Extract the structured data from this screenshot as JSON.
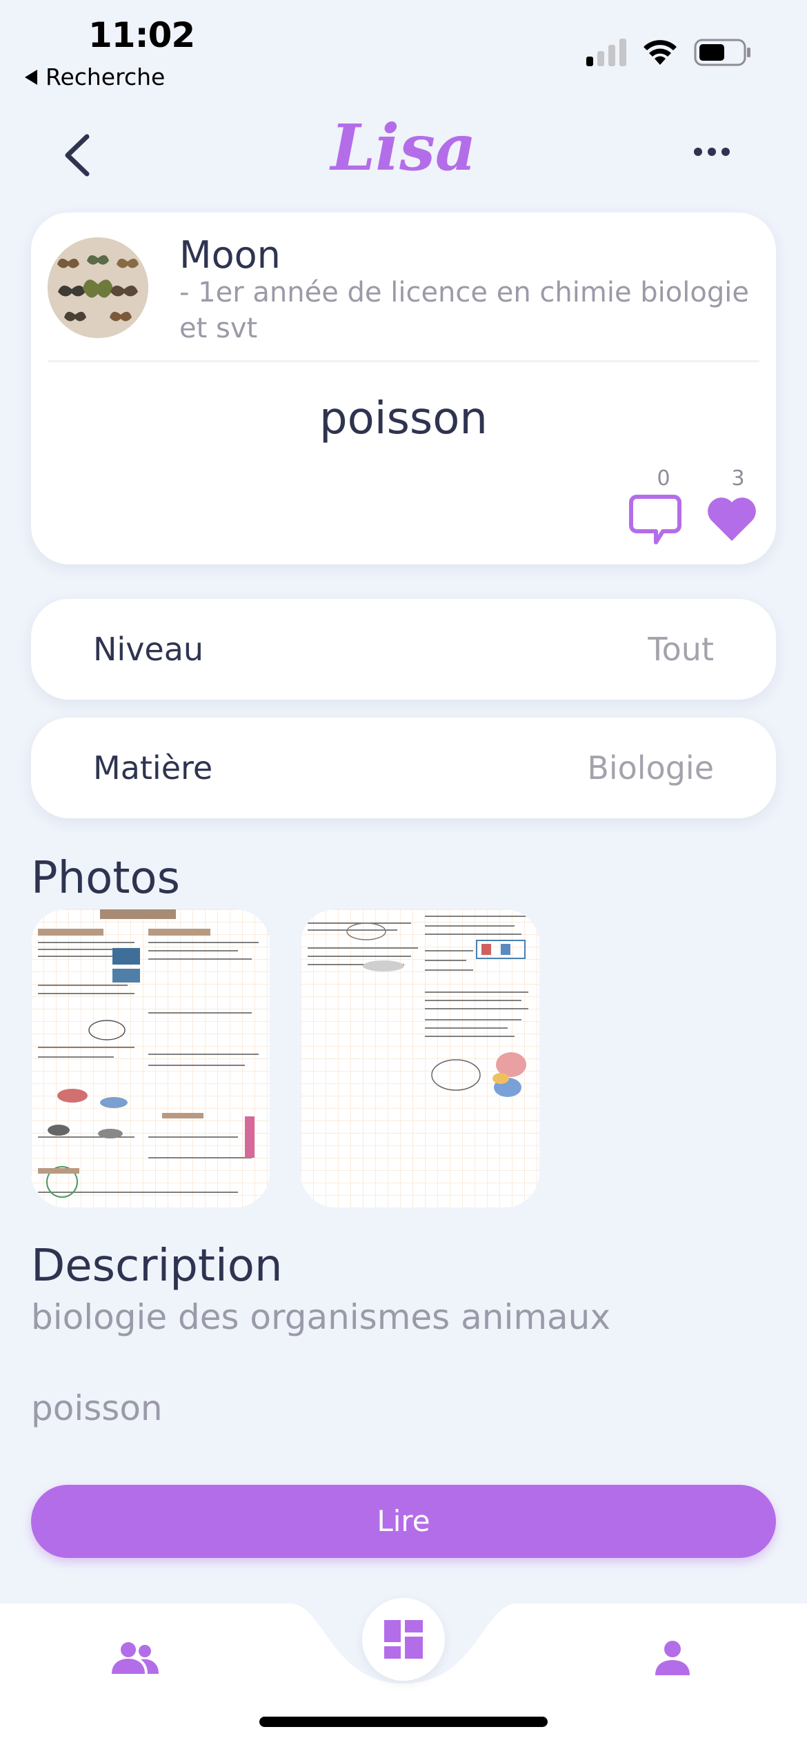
{
  "status_bar": {
    "time": "11:02",
    "back_app": "Recherche"
  },
  "header": {
    "app_title": "Lisa"
  },
  "post": {
    "author_name": "Moon",
    "author_meta": "- 1er année de licence en chimie biologie et svt",
    "title": "poisson",
    "comment_count": "0",
    "like_count": "3"
  },
  "filters": {
    "niveau": {
      "label": "Niveau",
      "value": "Tout"
    },
    "matiere": {
      "label": "Matière",
      "value": "Biologie"
    }
  },
  "photos": {
    "section_title": "Photos"
  },
  "description": {
    "section_title": "Description",
    "text": "biologie des organismes animaux",
    "extra": "poisson"
  },
  "actions": {
    "read_label": "Lire"
  },
  "colors": {
    "accent": "#b46de8",
    "text_dark": "#2e3450",
    "text_muted": "#9a9aa8",
    "background": "#eff3fa"
  },
  "icons": [
    "back-chevron-icon",
    "more-icon",
    "comment-icon",
    "heart-icon",
    "group-icon",
    "dashboard-icon",
    "person-icon"
  ]
}
